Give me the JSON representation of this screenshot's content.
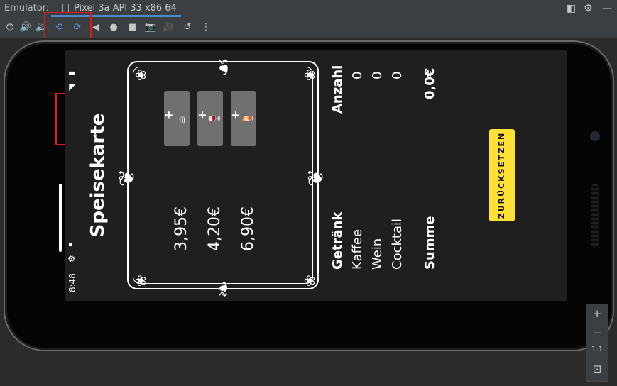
{
  "window": {
    "label": "Emulator:"
  },
  "tab": {
    "title": "Pixel 3a API 33 x86 64",
    "close": "×"
  },
  "toolbar": {
    "icons": [
      "power-icon",
      "volume-up-icon",
      "volume-down-icon",
      "rotate-left-icon",
      "rotate-right-icon",
      "back-icon",
      "home-icon",
      "overview-icon",
      "camera-icon",
      "screenrecord-icon",
      "snapshot-icon",
      "more-icon"
    ],
    "glyphs": {
      "power": "⏻",
      "vol_up": "🔊",
      "vol_down": "🔉",
      "rot_left": "⟲",
      "rot_right": "⟳",
      "back": "◀",
      "home": "●",
      "overview": "■",
      "camera": "📷",
      "record": "🎥",
      "snapshot": "↺",
      "more": "⋮"
    }
  },
  "phone": {
    "status": {
      "time": "8:48",
      "gear": "⚙",
      "sim": "▪",
      "wifi": "◥",
      "battery": "▮"
    },
    "rotate_glyph": "⟳",
    "app": {
      "title": "Speisekarte",
      "items": [
        {
          "price": "3,95€",
          "emoji": "☕",
          "plus": "+"
        },
        {
          "price": "4,20€",
          "emoji": "🍷",
          "plus": "+"
        },
        {
          "price": "6,90€",
          "emoji": "🍹",
          "plus": "+"
        }
      ],
      "table": {
        "header_drink": "Getränk",
        "header_count": "Anzahl",
        "rows": [
          {
            "name": "Kaffee",
            "count": "0"
          },
          {
            "name": "Wein",
            "count": "0"
          },
          {
            "name": "Cocktail",
            "count": "0"
          }
        ],
        "sum_label": "Summe",
        "sum_value": "0,0€"
      },
      "reset_button": "ZURÜCKSETZEN"
    }
  },
  "zoom_panel": {
    "plus": "+",
    "minus": "−",
    "one_to_one": "1:1",
    "fit": "⊡"
  },
  "colors": {
    "highlight_red": "#e01818",
    "reset_yellow": "#ffe135",
    "accent_blue": "#4a88c7"
  }
}
